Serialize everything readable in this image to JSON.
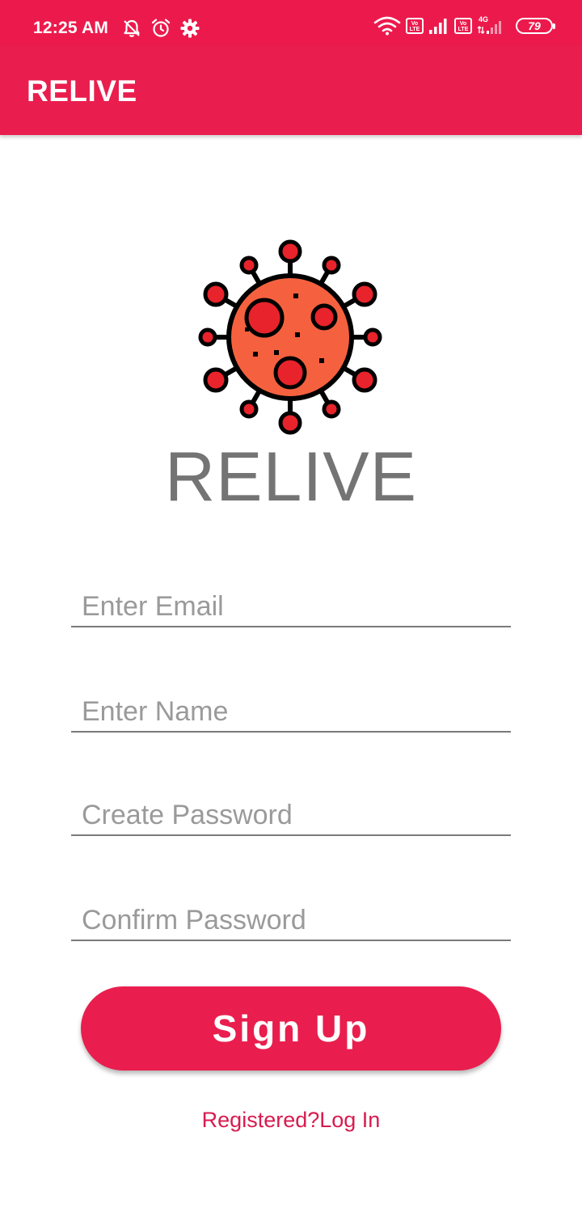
{
  "status_bar": {
    "time": "12:25 AM",
    "left_icons": [
      "bell-off-icon",
      "alarm-icon",
      "settings-gear-icon"
    ],
    "right_icons": [
      "wifi-icon",
      "volte-icon",
      "signal-icon",
      "volte-icon",
      "signal-4g-icon",
      "battery-icon"
    ],
    "volte_label_top": "Vo",
    "volte_label_bottom": "LTE",
    "network_type": "4G",
    "battery_level": "79"
  },
  "app_bar": {
    "title": "RELIVE"
  },
  "logo": {
    "icon": "virus-icon",
    "colors": {
      "body": "#f5613f",
      "accent": "#e8232b",
      "outline": "#000000"
    }
  },
  "brand": {
    "name": "RELIVE"
  },
  "form": {
    "email_placeholder": "Enter Email",
    "name_placeholder": "Enter Name",
    "password_placeholder": "Create Password",
    "confirm_password_placeholder": "Confirm Password",
    "email_value": "",
    "name_value": "",
    "password_value": "",
    "confirm_password_value": ""
  },
  "signup_button": {
    "label": "Sign Up"
  },
  "login_link": {
    "text": "Registered?Log In"
  },
  "colors": {
    "primary": "#e91e4e",
    "status_bar": "#ec1a4c",
    "brand_text": "#747474",
    "link": "#d81b4f",
    "placeholder": "#9a9a9a"
  }
}
